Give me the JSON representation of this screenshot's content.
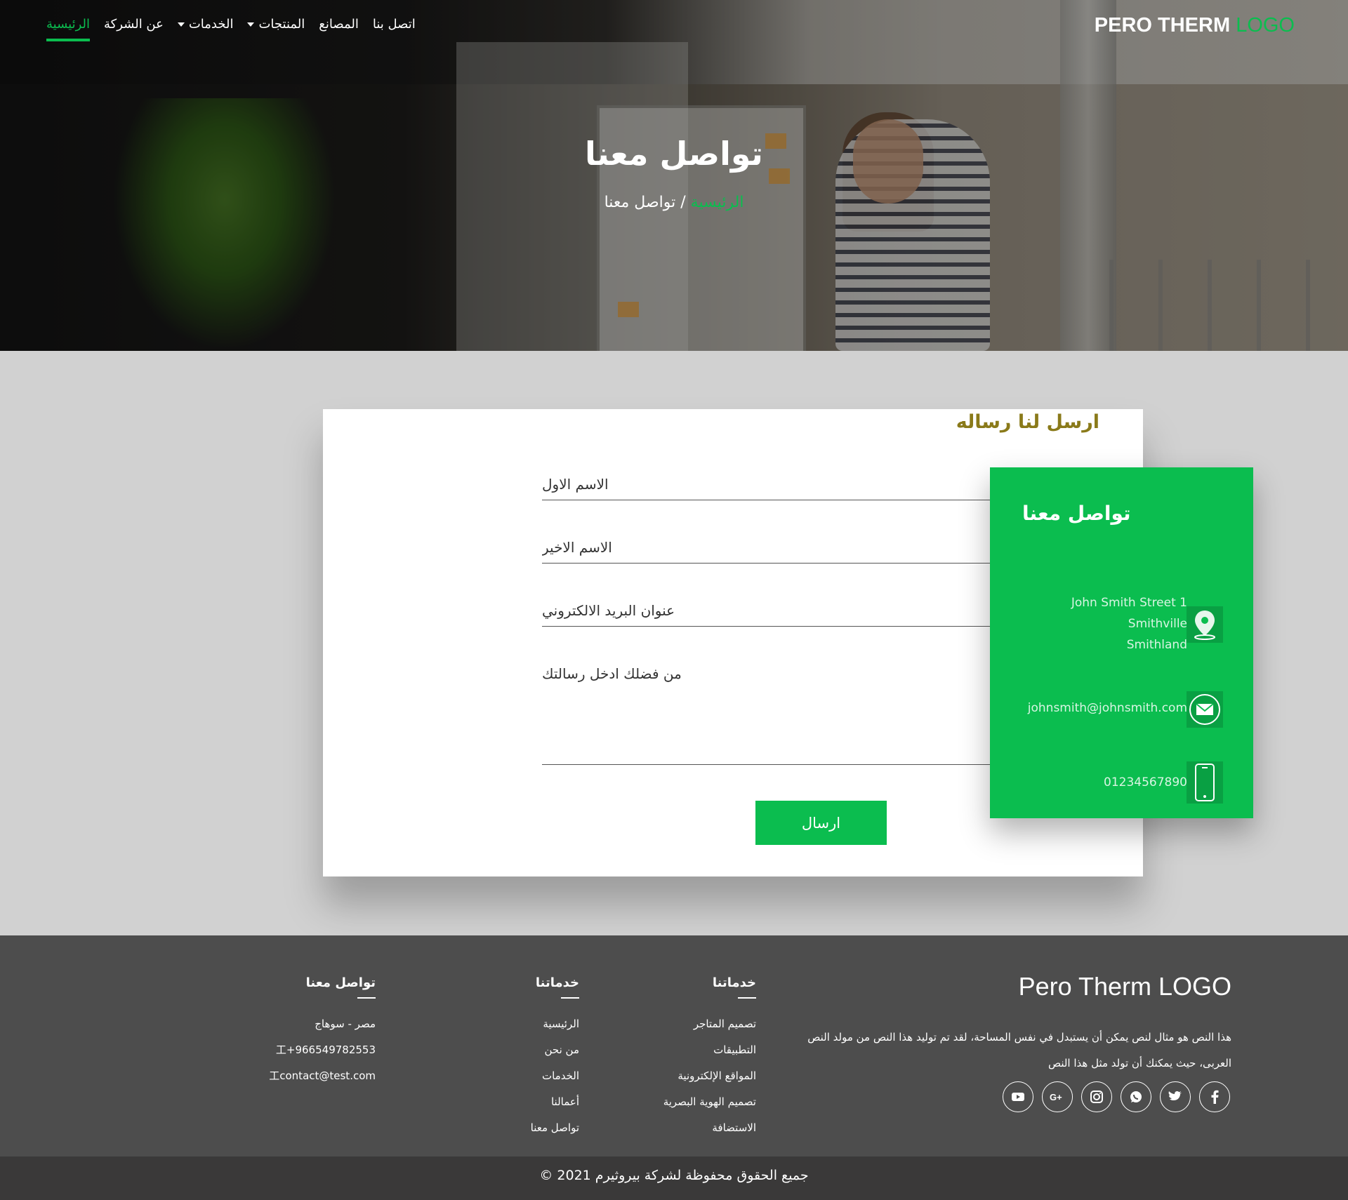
{
  "logo": {
    "main": "PERO THERM ",
    "accent": "LOGO"
  },
  "nav": {
    "items": [
      {
        "label": "الرئيسية",
        "active": true,
        "dropdown": false
      },
      {
        "label": "عن الشركة",
        "active": false,
        "dropdown": false
      },
      {
        "label": "الخدمات",
        "active": false,
        "dropdown": true
      },
      {
        "label": "المنتجات",
        "active": false,
        "dropdown": true
      },
      {
        "label": "المصانع",
        "active": false,
        "dropdown": false
      },
      {
        "label": "اتصل بنا",
        "active": false,
        "dropdown": false
      }
    ]
  },
  "hero": {
    "title": "تواصل معنا",
    "breadcrumb_home": "الرئيسية",
    "breadcrumb_sep": " / ",
    "breadcrumb_current": "تواصل معنا"
  },
  "form": {
    "title": "ارسل لنا رساله",
    "first_name_placeholder": "الاسم الاول",
    "last_name_placeholder": "الاسم الاخير",
    "email_placeholder": "عنوان البريد الالكتروني",
    "message_placeholder": "من فضلك ادخل رسالتك",
    "submit_label": "ارسال"
  },
  "contact_box": {
    "title": "تواصل معنا",
    "address_line1": "John Smith Street 1",
    "address_line2": "Smithville",
    "address_line3": "Smithland",
    "email": "johnsmith@johnsmith.com",
    "phone": "01234567890",
    "icons": [
      "location-pin-icon",
      "envelope-icon",
      "mobile-phone-icon"
    ]
  },
  "footer": {
    "logo": "Pero Therm LOGO",
    "description": "هذا النص هو مثال لنص يمكن أن يستبدل في نفس المساحة، لقد تم توليد هذا النص من مولد النص العربى، حيث يمكنك أن تولد مثل هذا النص",
    "socials": [
      "facebook-icon",
      "twitter-icon",
      "whatsapp-icon",
      "instagram-icon",
      "google-plus-icon",
      "youtube-icon"
    ],
    "col1": {
      "title": "خدماتنا",
      "links": [
        "تصميم المتاجر",
        "التطبيقات",
        "المواقع الإلكترونية",
        "تصميم الهوية البصرية",
        "الاستضافة"
      ]
    },
    "col2": {
      "title": "خدماتنا",
      "links": [
        "الرئيسية",
        "من نحن",
        "الخدمات",
        "أعمالنا",
        "تواصل معنا"
      ]
    },
    "col3": {
      "title": "تواصل معنا",
      "address": "مصر - سوهاج",
      "phone": "+966549782553",
      "email": "contact@test.com"
    },
    "copyright": "جميع الحقوق محفوظة لشركة بيروثيرم 2021 ©"
  },
  "colors": {
    "accent": "#0bbd4f",
    "form_title": "#8a7a1a",
    "footer_bg": "#4d4d4d",
    "copyright_bg": "#3a3939",
    "page_bg": "#d1d1d1"
  }
}
